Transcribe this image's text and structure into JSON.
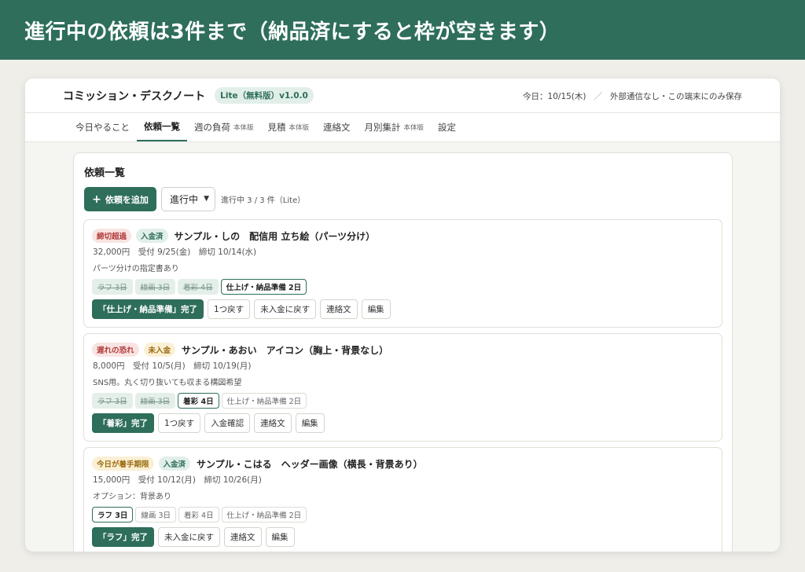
{
  "banner": {
    "text": "進行中の依頼は3件まで（納品済にすると枠が空きます）"
  },
  "app": {
    "title": "コミッション・デスクノート",
    "version_badge": "Lite（無料版）v1.0.0",
    "today": "今日：10/15(木)",
    "separator": "／",
    "privacy": "外部通信なし・この端末にのみ保存"
  },
  "tabs": [
    {
      "label": "今日やること",
      "sub": ""
    },
    {
      "label": "依頼一覧",
      "sub": "",
      "active": true
    },
    {
      "label": "週の負荷",
      "sub": "本体版"
    },
    {
      "label": "見積",
      "sub": "本体版"
    },
    {
      "label": "連絡文",
      "sub": ""
    },
    {
      "label": "月別集計",
      "sub": "本体版"
    },
    {
      "label": "設定",
      "sub": ""
    }
  ],
  "panel": {
    "title": "依頼一覧",
    "add_button": "依頼を追加",
    "add_icon": "plus-icon",
    "filter_value": "進行中",
    "count_text": "進行中 3 / 3 件（Lite）"
  },
  "cards": [
    {
      "badges": [
        {
          "text": "締切超過",
          "tone": "red"
        },
        {
          "text": "入金済",
          "tone": "green"
        }
      ],
      "title": "サンプル・しの　配信用 立ち絵（パーツ分け）",
      "meta": "32,000円　受付 9/25(金)　締切 10/14(水)",
      "note": "パーツ分けの指定書あり",
      "stages": [
        {
          "label": "ラフ 3日",
          "state": "done"
        },
        {
          "label": "線画 3日",
          "state": "done"
        },
        {
          "label": "着彩 4日",
          "state": "done"
        },
        {
          "label": "仕上げ・納品準備 2日",
          "state": "current"
        }
      ],
      "actions": [
        {
          "label": "「仕上げ・納品準備」完了",
          "primary": true
        },
        {
          "label": "1つ戻す"
        },
        {
          "label": "未入金に戻す"
        },
        {
          "label": "連絡文"
        },
        {
          "label": "編集"
        }
      ]
    },
    {
      "badges": [
        {
          "text": "遅れの恐れ",
          "tone": "red"
        },
        {
          "text": "未入金",
          "tone": "amber"
        }
      ],
      "title": "サンプル・あおい　アイコン（胸上・背景なし）",
      "meta": "8,000円　受付 10/5(月)　締切 10/19(月)",
      "note": "SNS用。丸く切り抜いても収まる構図希望",
      "stages": [
        {
          "label": "ラフ 3日",
          "state": "done"
        },
        {
          "label": "線画 3日",
          "state": "done"
        },
        {
          "label": "着彩 4日",
          "state": "current"
        },
        {
          "label": "仕上げ・納品準備 2日",
          "state": "todo"
        }
      ],
      "actions": [
        {
          "label": "「着彩」完了",
          "primary": true
        },
        {
          "label": "1つ戻す"
        },
        {
          "label": "入金確認"
        },
        {
          "label": "連絡文"
        },
        {
          "label": "編集"
        }
      ]
    },
    {
      "badges": [
        {
          "text": "今日が着手期限",
          "tone": "amber"
        },
        {
          "text": "入金済",
          "tone": "green"
        }
      ],
      "title": "サンプル・こはる　ヘッダー画像（横長・背景あり）",
      "meta": "15,000円　受付 10/12(月)　締切 10/26(月)",
      "note": "オプション：背景あり",
      "stages": [
        {
          "label": "ラフ 3日",
          "state": "current"
        },
        {
          "label": "線画 3日",
          "state": "todo"
        },
        {
          "label": "着彩 4日",
          "state": "todo"
        },
        {
          "label": "仕上げ・納品準備 2日",
          "state": "todo"
        }
      ],
      "actions": [
        {
          "label": "「ラフ」完了",
          "primary": true
        },
        {
          "label": "未入金に戻す"
        },
        {
          "label": "連絡文"
        },
        {
          "label": "編集"
        }
      ]
    }
  ]
}
